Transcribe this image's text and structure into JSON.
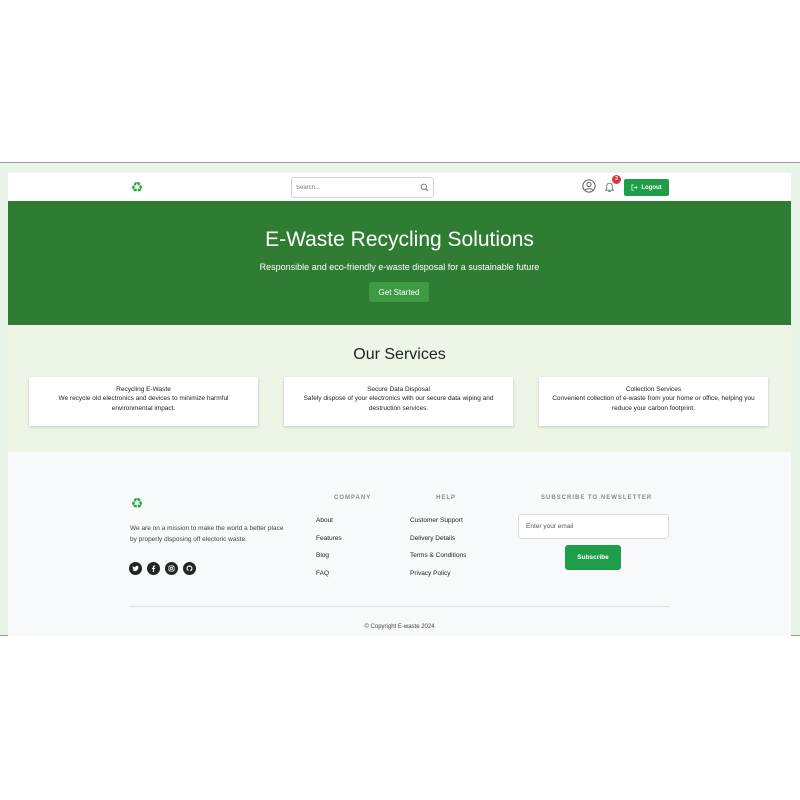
{
  "navbar": {
    "logo_icon": "recycle-icon",
    "search_placeholder": "Search...",
    "notification_count": "3",
    "logout_label": "Logout"
  },
  "hero": {
    "title": "E-Waste Recycling Solutions",
    "subtitle": "Responsible and eco-friendly e-waste disposal for a sustainable future",
    "cta_label": "Get Started"
  },
  "services": {
    "heading": "Our Services",
    "cards": [
      {
        "title": "Recycling E-Waste",
        "description": "We recycle old electronics and devices to minimize harmful environmental impact."
      },
      {
        "title": "Secure Data Disposal",
        "description": "Safely dispose of your electronics with our secure data wiping and destruction services."
      },
      {
        "title": "Collection Services",
        "description": "Convenient collection of e-waste from your home or office, helping you reduce your carbon footprint."
      }
    ]
  },
  "footer": {
    "about": "We are on a mission to make the world a better place by properly disposing off electoric waste.",
    "socials": [
      "twitter-icon",
      "facebook-icon",
      "instagram-icon",
      "github-icon"
    ],
    "company": {
      "title": "COMPANY",
      "links": [
        "About",
        "Features",
        "Blog",
        "FAQ"
      ]
    },
    "help": {
      "title": "HELP",
      "links": [
        "Customer Support",
        "Delivery Details",
        "Terms & Conditions",
        "Privacy Policy"
      ]
    },
    "newsletter": {
      "title": "SUBSCRIBE TO NEWSLETTER",
      "email_placeholder": "Enter your email",
      "button_label": "Subscribe"
    },
    "copyright": "© Copyright E-waste 2024"
  },
  "colors": {
    "primary_green": "#2e7d32",
    "button_green": "#1e9e48",
    "services_bg": "#edf5e6",
    "badge_red": "#dc3545"
  }
}
